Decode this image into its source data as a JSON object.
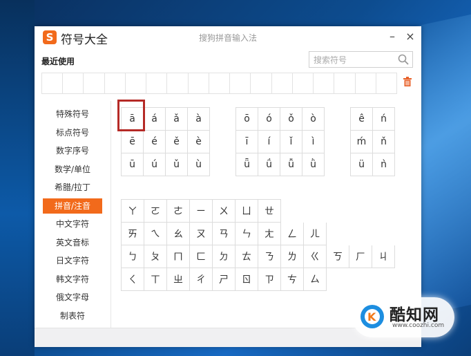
{
  "window": {
    "title": "符号大全",
    "subtitle": "搜狗拼音输入法",
    "minimize": "–",
    "close": "×"
  },
  "recent": {
    "label": "最近使用"
  },
  "search": {
    "placeholder": "搜索符号"
  },
  "sidebar": {
    "items": [
      {
        "label": "特殊符号"
      },
      {
        "label": "标点符号"
      },
      {
        "label": "数字序号"
      },
      {
        "label": "数学/单位"
      },
      {
        "label": "希腊/拉丁"
      },
      {
        "label": "拼音/注音"
      },
      {
        "label": "中文字符"
      },
      {
        "label": "英文音标"
      },
      {
        "label": "日文字符"
      },
      {
        "label": "韩文字符"
      },
      {
        "label": "俄文字母"
      },
      {
        "label": "制表符"
      }
    ],
    "active_index": 5
  },
  "pinyin": {
    "group_a": [
      [
        "ā",
        "á",
        "ǎ",
        "à"
      ],
      [
        "ē",
        "é",
        "ě",
        "è"
      ],
      [
        "ū",
        "ú",
        "ǔ",
        "ù"
      ]
    ],
    "group_o": [
      [
        "ō",
        "ó",
        "ǒ",
        "ò"
      ],
      [
        "ī",
        "í",
        "ǐ",
        "ì"
      ],
      [
        "ǖ",
        "ǘ",
        "ǚ",
        "ǜ"
      ]
    ],
    "group_e": [
      [
        "ê",
        "ń"
      ],
      [
        "ḿ",
        "ň"
      ],
      [
        "ü",
        "ǹ"
      ]
    ]
  },
  "zhuyin": {
    "rows": [
      [
        "ㄚ",
        "ㄛ",
        "ㄜ",
        "ㄧ",
        "ㄨ",
        "ㄩ",
        "ㄝ"
      ],
      [
        "ㄞ",
        "ㄟ",
        "ㄠ",
        "ㄡ",
        "ㄢ",
        "ㄣ",
        "ㄤ",
        "ㄥ",
        "ㄦ"
      ],
      [
        "ㄅ",
        "ㄆ",
        "ㄇ",
        "ㄈ",
        "ㄉ",
        "ㄊ",
        "ㄋ",
        "ㄌ",
        "ㄍ",
        "ㄎ",
        "ㄏ",
        "ㄐ"
      ],
      [
        "ㄑ",
        "ㄒ",
        "ㄓ",
        "ㄔ",
        "ㄕ",
        "ㄖ",
        "ㄗ",
        "ㄘ",
        "ㄙ"
      ]
    ]
  },
  "watermark": {
    "name": "酷知网",
    "url": "www.coozhi.com"
  },
  "colors": {
    "accent": "#f26a1b",
    "selection": "#b52a26"
  }
}
